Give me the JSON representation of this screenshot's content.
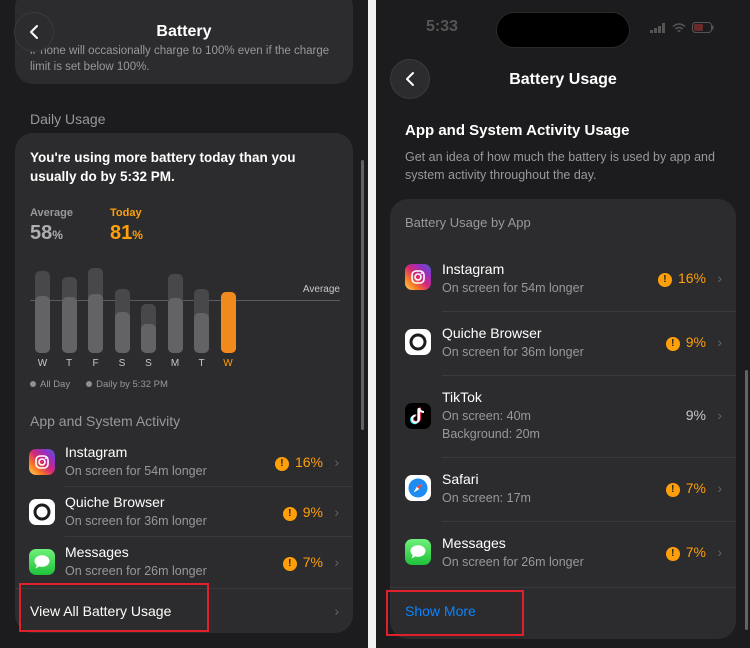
{
  "left": {
    "title": "Battery",
    "top_note": "iPhone will occasionally charge to 100% even if the charge limit is set below 100%.",
    "daily_usage_label": "Daily Usage",
    "daily_message": "You're using more battery today than you usually do by 5:32 PM.",
    "average_label": "Average",
    "average_value": "58",
    "today_label": "Today",
    "today_value": "81",
    "percent_sign": "%",
    "chart_avg_label": "Average",
    "legend_all_day": "All Day",
    "legend_daily_by": "Daily by 5:32 PM",
    "activity_label": "App and System Activity",
    "apps": [
      {
        "name": "Instagram",
        "sub": "On screen for 54m longer",
        "pct": "16%"
      },
      {
        "name": "Quiche Browser",
        "sub": "On screen for 36m longer",
        "pct": "9%"
      },
      {
        "name": "Messages",
        "sub": "On screen for 26m longer",
        "pct": "7%"
      }
    ],
    "view_all": "View All Battery Usage",
    "colors": {
      "accent": "#ff9f0a",
      "highlight": "#e0202a"
    }
  },
  "chart_data": {
    "type": "bar",
    "categories": [
      "W",
      "T",
      "F",
      "S",
      "S",
      "M",
      "T",
      "W"
    ],
    "series": [
      {
        "values": [
          89,
          83,
          92,
          70,
          53,
          86,
          70,
          66
        ]
      },
      {
        "values": [
          62,
          61,
          64,
          45,
          31,
          60,
          43,
          66
        ]
      }
    ],
    "average": 58,
    "today": 81,
    "ylim": [
      0,
      100
    ],
    "legend": [
      "All Day",
      "Daily by 5:32 PM"
    ],
    "legend_position": "bottom-left"
  },
  "right": {
    "status_time": "5:33",
    "title": "Battery Usage",
    "usage_title": "App and System Activity Usage",
    "usage_desc": "Get an idea of how much the battery is used by app and system activity throughout the day.",
    "card_header": "Battery Usage by App",
    "apps": [
      {
        "name": "Instagram",
        "sub": "On screen for 54m longer",
        "pct": "16%"
      },
      {
        "name": "Quiche Browser",
        "sub": "On screen for 36m longer",
        "pct": "9%"
      },
      {
        "name": "TikTok",
        "sub": "On screen: 40m",
        "sub2": "Background: 20m",
        "pct": "9%"
      },
      {
        "name": "Safari",
        "sub": "On screen: 17m",
        "pct": "7%"
      },
      {
        "name": "Messages",
        "sub": "On screen for 26m longer",
        "pct": "7%"
      }
    ],
    "show_more": "Show More",
    "colors": {
      "link": "#0a84ff"
    }
  }
}
